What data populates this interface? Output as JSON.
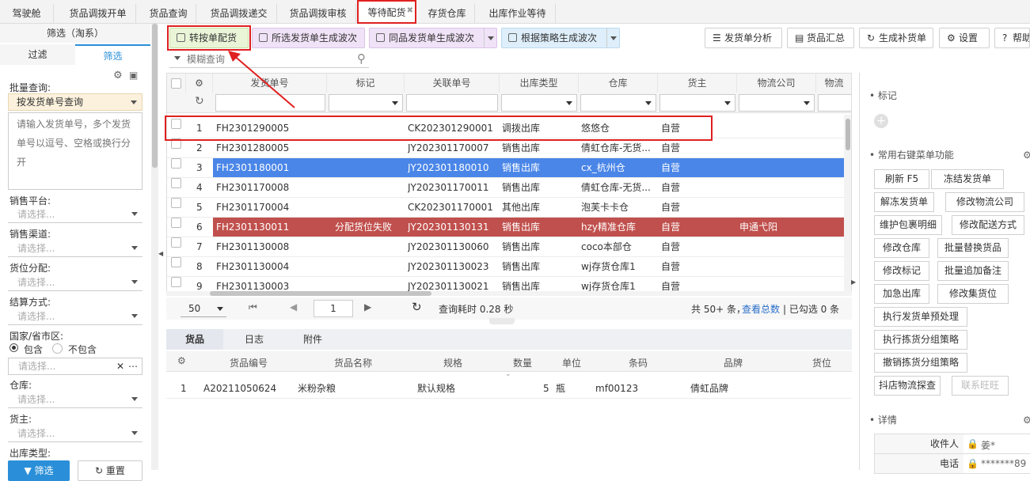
{
  "tabs": [
    {
      "label": "驾驶舱",
      "active": false
    },
    {
      "label": "货品调拨开单",
      "active": false
    },
    {
      "label": "货品查询",
      "active": false
    },
    {
      "label": "货品调拨递交",
      "active": false
    },
    {
      "label": "货品调拨审核",
      "active": false
    },
    {
      "label": "等待配货",
      "active": true
    },
    {
      "label": "存货仓库",
      "active": false
    },
    {
      "label": "出库作业等待",
      "active": false
    }
  ],
  "left": {
    "title": "筛选（淘系）",
    "tab_filter": "过滤",
    "tab_select": "筛选",
    "batch_label": "批量查询:",
    "batch_mode": "按发货单号查询",
    "batch_placeholder": "请输入发货单号，多个发货单号以逗号、空格或换行分开",
    "platform_label": "销售平台:",
    "channel_label": "销售渠道:",
    "alloc_label": "货位分配:",
    "settle_label": "结算方式:",
    "region_label": "国家/省市区:",
    "include": "包含",
    "exclude": "不包含",
    "warehouse_label": "仓库:",
    "owner_label": "货主:",
    "outtype_label": "出库类型:",
    "select_placeholder": "请选择...",
    "filter_btn": "筛选",
    "reset_btn": "重置"
  },
  "toolbar": {
    "btn1": "转按单配货",
    "btn2": "所选发货单生成波次",
    "btn3": "同品发货单生成波次",
    "btn4": "根据策略生成波次",
    "btn5": "发货单分析",
    "btn6": "货品汇总",
    "btn7": "生成补货单",
    "btn8": "设置",
    "btn9": "帮助",
    "search_placeholder": "模糊查询"
  },
  "grid": {
    "columns": [
      "发货单号",
      "标记",
      "关联单号",
      "出库类型",
      "仓库",
      "货主",
      "物流公司",
      "物流"
    ],
    "rows": [
      {
        "no": "1",
        "order": "FH2301290005",
        "mark": "",
        "ref": "CK202301290001",
        "type": "调拨出库",
        "wh": "悠悠仓",
        "owner": "自营",
        "logistics": "",
        "state": "normal"
      },
      {
        "no": "2",
        "order": "FH2301280005",
        "mark": "",
        "ref": "JY202301170007",
        "type": "销售出库",
        "wh": "倩虹仓库-无货...",
        "owner": "自营",
        "logistics": "",
        "state": "normal"
      },
      {
        "no": "3",
        "order": "FH2301180001",
        "mark": "",
        "ref": "JY202301180010",
        "type": "销售出库",
        "wh": "cx_杭州仓",
        "owner": "自营",
        "logistics": "",
        "state": "selected"
      },
      {
        "no": "4",
        "order": "FH2301170008",
        "mark": "",
        "ref": "JY202301170011",
        "type": "销售出库",
        "wh": "倩虹仓库-无货...",
        "owner": "自营",
        "logistics": "",
        "state": "normal"
      },
      {
        "no": "5",
        "order": "FH2301170004",
        "mark": "",
        "ref": "CK202301170001",
        "type": "其他出库",
        "wh": "泡芙卡卡仓",
        "owner": "自营",
        "logistics": "",
        "state": "normal"
      },
      {
        "no": "6",
        "order": "FH2301130011",
        "mark": "分配货位失败",
        "ref": "JY202301130131",
        "type": "销售出库",
        "wh": "hzy精准仓库",
        "owner": "自营",
        "logistics": "申通弋阳",
        "state": "error"
      },
      {
        "no": "7",
        "order": "FH2301130008",
        "mark": "",
        "ref": "JY202301130060",
        "type": "销售出库",
        "wh": "coco本部仓",
        "owner": "自营",
        "logistics": "",
        "state": "normal"
      },
      {
        "no": "8",
        "order": "FH2301130004",
        "mark": "",
        "ref": "JY202301130023",
        "type": "销售出库",
        "wh": "wj存货仓库1",
        "owner": "自营",
        "logistics": "",
        "state": "normal"
      },
      {
        "no": "9",
        "order": "FH2301130003",
        "mark": "",
        "ref": "JY202301130021",
        "type": "销售出库",
        "wh": "wj存货仓库1",
        "owner": "自营",
        "logistics": "",
        "state": "normal"
      }
    ]
  },
  "pager": {
    "page_size": "50",
    "page": "1",
    "elapsed": "查询耗时 0.28 秒",
    "total": "共 50+ 条，",
    "view_total": "查看总数",
    "checked": "| 已勾选 0 条"
  },
  "detail": {
    "tabs": [
      "货品",
      "日志",
      "附件"
    ],
    "columns": [
      "货品编号",
      "货品名称",
      "规格",
      "数量",
      "单位",
      "条码",
      "品牌",
      "货位"
    ],
    "rows": [
      {
        "no": "1",
        "code": "A20211050624",
        "name": "米粉杂粮",
        "spec": "默认规格",
        "qty": "5",
        "unit": "瓶",
        "barcode": "mf00123",
        "brand": "倩虹品牌",
        "loc": ""
      }
    ]
  },
  "right": {
    "mark_title": "标记",
    "menu_title": "常用右键菜单功能",
    "buttons": [
      {
        "label": "刷新 F5",
        "disabled": false
      },
      {
        "label": "冻结发货单",
        "disabled": false
      },
      {
        "label": "解冻发货单",
        "disabled": false
      },
      {
        "label": "修改物流公司",
        "disabled": false
      },
      {
        "label": "维护包裹明细",
        "disabled": false
      },
      {
        "label": "修改配送方式",
        "disabled": false
      },
      {
        "label": "修改仓库",
        "disabled": false
      },
      {
        "label": "批量替换货品",
        "disabled": false
      },
      {
        "label": "修改标记",
        "disabled": false
      },
      {
        "label": "批量追加备注",
        "disabled": false
      },
      {
        "label": "加急出库",
        "disabled": false
      },
      {
        "label": "修改集货位",
        "disabled": false
      },
      {
        "label": "执行发货单预处理",
        "disabled": false
      },
      {
        "label": "执行拣货分组策略",
        "disabled": false
      },
      {
        "label": "撤销拣货分组策略",
        "disabled": false
      },
      {
        "label": "抖店物流探查",
        "disabled": false
      },
      {
        "label": "联系旺旺",
        "disabled": true
      }
    ],
    "detail_title": "详情",
    "receiver_label": "收件人",
    "receiver_value": "姜*",
    "phone_label": "电话",
    "phone_value": "*******89"
  },
  "colors": {
    "selected": "#4a86e8",
    "error": "#c0504d",
    "highlight": "#e02020"
  }
}
